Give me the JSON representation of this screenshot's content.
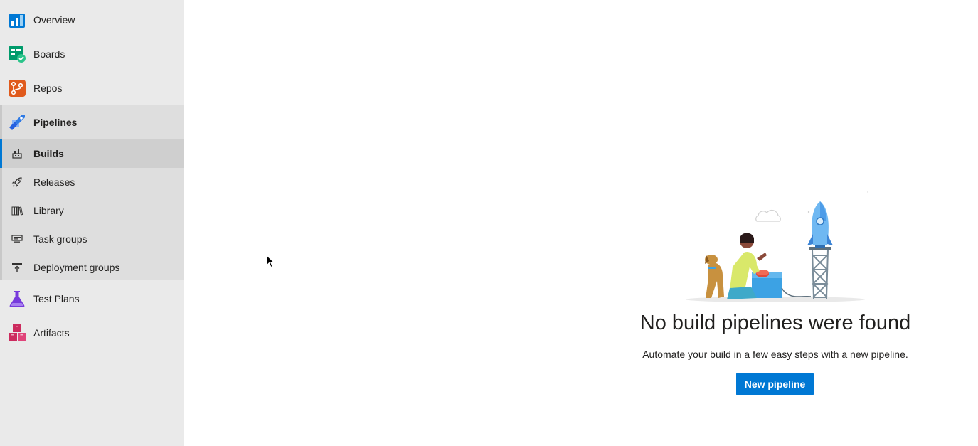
{
  "sidebar": {
    "items": [
      {
        "label": "Overview",
        "icon": "overview-icon"
      },
      {
        "label": "Boards",
        "icon": "boards-icon"
      },
      {
        "label": "Repos",
        "icon": "repos-icon"
      },
      {
        "label": "Pipelines",
        "icon": "pipelines-icon"
      },
      {
        "label": "Test Plans",
        "icon": "test-plans-icon"
      },
      {
        "label": "Artifacts",
        "icon": "artifacts-icon"
      }
    ],
    "pipelines_sub": [
      {
        "label": "Builds",
        "icon": "builds-icon",
        "selected": true
      },
      {
        "label": "Releases",
        "icon": "rocket-icon"
      },
      {
        "label": "Library",
        "icon": "library-icon"
      },
      {
        "label": "Task groups",
        "icon": "task-groups-icon"
      },
      {
        "label": "Deployment groups",
        "icon": "deployment-groups-icon"
      }
    ]
  },
  "main": {
    "empty_title": "No build pipelines were found",
    "empty_subtitle": "Automate your build in a few easy steps with a new pipeline.",
    "new_pipeline_label": "New pipeline"
  },
  "colors": {
    "accent": "#0078d4",
    "sidebar_bg": "#eaeaea",
    "sub_group_bg": "#dedede"
  }
}
